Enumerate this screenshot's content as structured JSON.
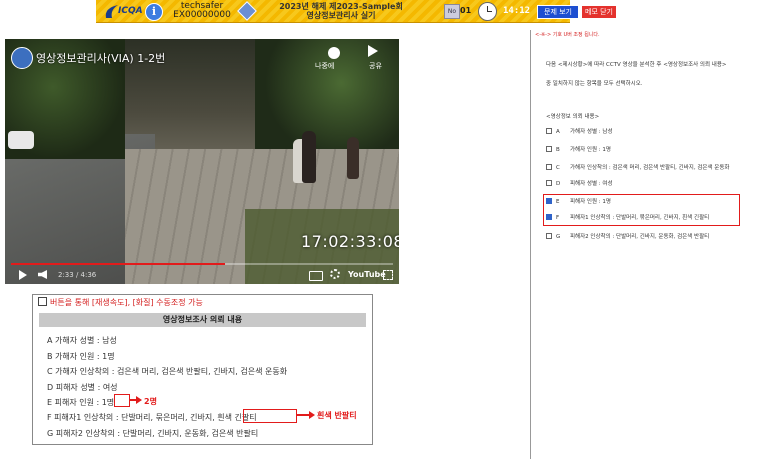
{
  "topbar": {
    "logo_text": "ICQA",
    "user_name": "techsafer",
    "user_id": "EX00000000",
    "exam_title_line1": "2023년 해제 제2023-Sample회",
    "exam_title_line2": "영상정보관리사 실기",
    "question_icon": "No",
    "question_number": "01",
    "timer": "14:12",
    "btn_view_problem": "문제 보기",
    "btn_close_memo": "메모 닫기",
    "colors": {
      "bar": "#f4b800",
      "blue": "#1d4fd1",
      "red": "#e4322d"
    }
  },
  "video": {
    "channel_title": "영상정보관리사(VIA) 1-2번",
    "watch_later_label": "나중에",
    "share_label": "공유",
    "timestamp": "17:02:33:08",
    "time_display": "2:33 / 4:36",
    "progress": 0.56,
    "youtube_label": "YouTube"
  },
  "panel": {
    "note": "버튼을 통해 [재생속도], [화질] 수동조정 가능",
    "heading": "영상정보조사 의뢰 내용",
    "lines": [
      "A 가해자 성별 : 남성",
      "B 가해자 인원 : 1명",
      "C 가해자 인상착의 : 검은색 머리, 검은색 반팔티, 긴바지, 검은색 운동화",
      "D 피해자 성별 : 여성",
      "E 피해자 인원 : 1명",
      "F 피해자1 인상착의 : 단발머리, 묶은머리, 긴바지, 흰색 긴팔티",
      "G 피해자2 인상착의 : 단발머리, 긴바지, 운동화, 검은색 반팔티"
    ],
    "annotation_e": "2명",
    "annotation_f": "흰색 반팔티"
  },
  "right": {
    "title": "<-※-> 기호 U버 조정 됩니다.",
    "instruction_line1": "다음 <제시상황>에 따라 CCTV 영상을 분석한 후 <영상정보조사 의뢰 내용>",
    "instruction_line2": "중 일치하지 않는 항목을 모두 선택하시오.",
    "section_label": "<영상정보 의뢰 내용>",
    "options": [
      {
        "letter": "A",
        "text": "가해자 성별 : 남성",
        "checked": false
      },
      {
        "letter": "B",
        "text": "가해자 인원 : 1명",
        "checked": false
      },
      {
        "letter": "C",
        "text": "가해자 인상착의 : 검은색 머리, 검은색 반팔티, 긴바지, 검은색 운동화",
        "checked": false
      },
      {
        "letter": "D",
        "text": "피해자 성별 : 여성",
        "checked": false
      },
      {
        "letter": "E",
        "text": "피해자 인원 : 1명",
        "checked": true
      },
      {
        "letter": "F",
        "text": "피해자1 인상착의 : 단발머리, 묶은머리, 긴바지, 흰색 긴팔티",
        "checked": true
      },
      {
        "letter": "G",
        "text": "피해자2 인상착의 : 단발머리, 긴바지, 운동화, 검은색 반팔티",
        "checked": false
      }
    ]
  }
}
